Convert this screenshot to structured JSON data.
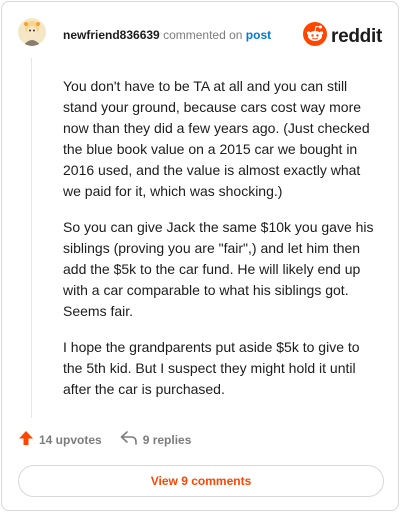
{
  "comment": {
    "username": "newfriend836639",
    "action_text": "commented on",
    "post_link_text": "post",
    "brand": "reddit",
    "paragraphs": [
      "You don't have to be TA at all and you can still stand your ground, because cars cost way more now than they did a few years ago. (Just checked the blue book value on a 2015 car we bought in 2016 used, and the value is almost exactly what we paid for it, which was shocking.)",
      "So you can give Jack the same $10k you gave his siblings (proving you are \"fair\",) and let him then add the $5k to the car fund. He will likely end up with a car comparable to what his siblings got. Seems fair.",
      "I hope the grandparents put aside $5k to give to the 5th kid. But I suspect they might hold it until after the car is purchased."
    ],
    "upvotes_text": "14 upvotes",
    "replies_text": "9 replies",
    "view_comments_label": "View 9 comments"
  },
  "icons": {
    "avatar": "avatar-icon",
    "reddit_logo": "reddit-logo-icon",
    "upvote": "upvote-arrow-icon",
    "reply": "reply-arrow-icon"
  },
  "colors": {
    "accent": "#ff4500",
    "link": "#0079d3",
    "muted": "#7c7c7c",
    "border": "#d6d8da"
  }
}
